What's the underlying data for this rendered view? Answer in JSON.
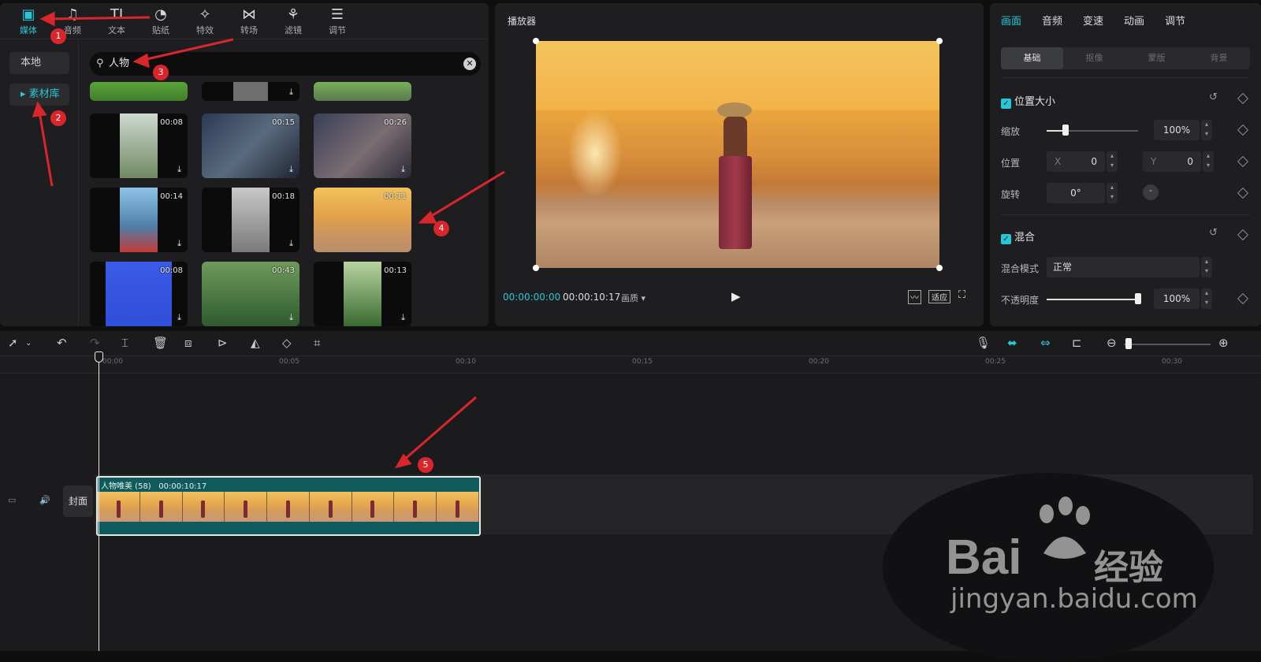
{
  "media_tabs": [
    {
      "label": "媒体",
      "icon": "play-square-icon"
    },
    {
      "label": "音频",
      "icon": "music-note-icon"
    },
    {
      "label": "文本",
      "icon": "text-tt-icon"
    },
    {
      "label": "贴纸",
      "icon": "sticker-icon"
    },
    {
      "label": "特效",
      "icon": "effect-star-icon"
    },
    {
      "label": "转场",
      "icon": "transition-bowtie-icon"
    },
    {
      "label": "滤镜",
      "icon": "filter-circles-icon"
    },
    {
      "label": "调节",
      "icon": "sliders-icon"
    }
  ],
  "sidebar": {
    "local": "本地",
    "library": "▸ 素材库"
  },
  "search": {
    "query": "人物"
  },
  "thumbs": [
    {
      "dur": "00:08"
    },
    {
      "dur": "00:15"
    },
    {
      "dur": "00:26"
    },
    {
      "dur": "00:14"
    },
    {
      "dur": "00:18"
    },
    {
      "dur": "00:11"
    },
    {
      "dur": "00:08"
    },
    {
      "dur": "00:43"
    },
    {
      "dur": "00:13"
    }
  ],
  "player": {
    "title": "播放器",
    "current_time": "00:00:00:00",
    "total_time": "00:00:10:17",
    "quality": "画质 ▾",
    "fit": "适应"
  },
  "props": {
    "tabs": [
      "画面",
      "音频",
      "变速",
      "动画",
      "调节"
    ],
    "sub_tabs": [
      "基础",
      "抠像",
      "蒙版",
      "背景"
    ],
    "section_position": "位置大小",
    "scale_label": "缩放",
    "scale_value": "100%",
    "position_label": "位置",
    "x_label": "X",
    "x_value": "0",
    "y_label": "Y",
    "y_value": "0",
    "rotate_label": "旋转",
    "rotate_value": "0°",
    "section_blend": "混合",
    "blend_mode_label": "混合模式",
    "blend_mode_value": "正常",
    "opacity_label": "不透明度",
    "opacity_value": "100%"
  },
  "timeline": {
    "ticks": [
      "00:00",
      "00:05",
      "00:10",
      "00:15",
      "00:20",
      "00:25",
      "00:30"
    ],
    "clip_name": "人物唯美 (58)",
    "clip_duration": "00:00:10:17",
    "cover_label": "封面"
  },
  "annotations": [
    "1",
    "2",
    "3",
    "4",
    "5"
  ],
  "watermark": {
    "brand": "Bai",
    "brand_cn": "经验",
    "url": "jingyan.baidu.com"
  },
  "colors": {
    "accent": "#28c7d6",
    "annotation": "#d8262c"
  }
}
